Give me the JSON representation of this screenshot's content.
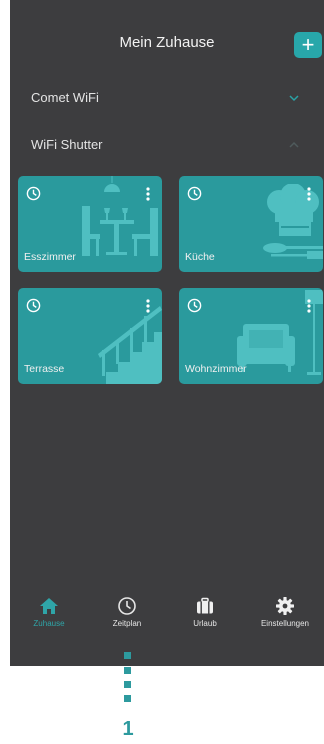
{
  "header": {
    "title": "Mein Zuhause",
    "add_label": "+"
  },
  "groups": [
    {
      "label": "Comet WiFi",
      "state": "collapsed"
    },
    {
      "label": "WiFi Shutter",
      "state": "expanded"
    }
  ],
  "rooms": [
    {
      "label": "Esszimmer",
      "icon": "dining-room-icon"
    },
    {
      "label": "Küche",
      "icon": "kitchen-icon"
    },
    {
      "label": "Terrasse",
      "icon": "stairs-icon"
    },
    {
      "label": "Wohnzimmer",
      "icon": "living-room-icon"
    }
  ],
  "nav": [
    {
      "label": "Zuhause",
      "icon": "home-icon",
      "active": true
    },
    {
      "label": "Zeitplan",
      "icon": "clock-icon",
      "active": false
    },
    {
      "label": "Urlaub",
      "icon": "suitcase-icon",
      "active": false
    },
    {
      "label": "Einstellungen",
      "icon": "gear-icon",
      "active": false
    }
  ],
  "callout": {
    "number": "1"
  },
  "colors": {
    "background": "#3d3d3f",
    "accent": "#2a9a9d",
    "text": "#f2f2f2"
  }
}
